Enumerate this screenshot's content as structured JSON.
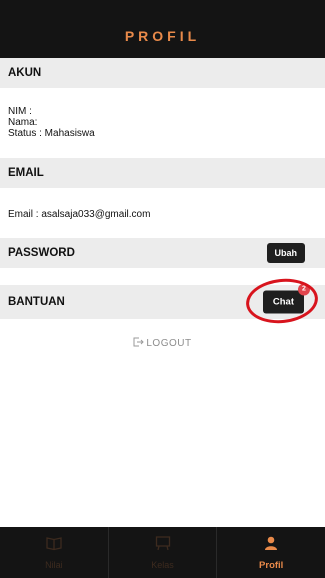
{
  "header": {
    "title": "PROFIL"
  },
  "akun": {
    "heading": "AKUN",
    "nim": "NIM :",
    "nama": "Nama:",
    "status": "Status : Mahasiswa"
  },
  "email": {
    "heading": "EMAIL",
    "value": "Email : asalsaja033@gmail.com"
  },
  "password": {
    "heading": "PASSWORD",
    "button": "Ubah"
  },
  "bantuan": {
    "heading": "BANTUAN",
    "button": "Chat",
    "badge": "2"
  },
  "logout": {
    "label": "LOGOUT"
  },
  "nav": {
    "items": [
      {
        "label": "Nilai",
        "icon": "book-icon"
      },
      {
        "label": "Kelas",
        "icon": "board-icon"
      },
      {
        "label": "Profil",
        "icon": "person-icon",
        "active": true
      }
    ]
  },
  "colors": {
    "accent": "#e98a4a",
    "header_bg": "#141414",
    "section_bg": "#ececec",
    "annotation": "#d8141d"
  }
}
